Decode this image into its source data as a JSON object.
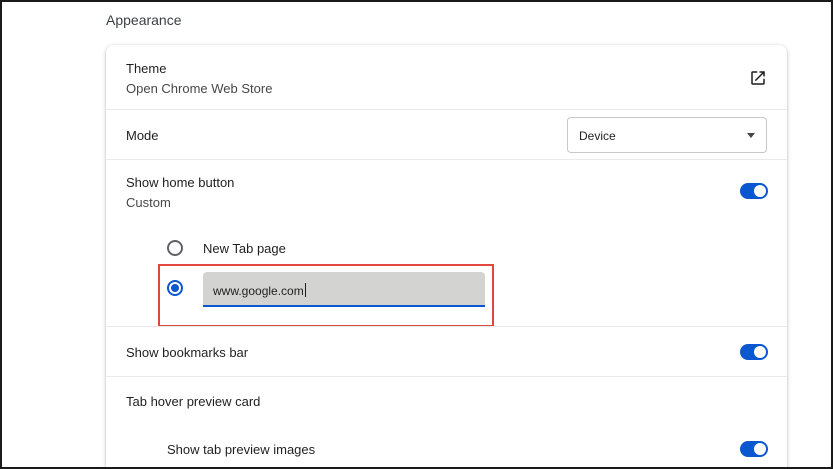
{
  "section": {
    "title": "Appearance"
  },
  "theme": {
    "label": "Theme",
    "sublabel": "Open Chrome Web Store",
    "icon": "open-in-new-icon"
  },
  "mode": {
    "label": "Mode",
    "selected": "Device"
  },
  "home_button": {
    "label": "Show home button",
    "sublabel": "Custom",
    "enabled": true,
    "options": [
      {
        "label": "New Tab page",
        "selected": false
      },
      {
        "label": "custom-url",
        "selected": true
      }
    ],
    "url_value": "www.google.com"
  },
  "bookmarks_bar": {
    "label": "Show bookmarks bar",
    "enabled": true
  },
  "tab_hover": {
    "label": "Tab hover preview card",
    "preview_images_label": "Show tab preview images",
    "preview_images_enabled": true
  },
  "colors": {
    "accent": "#0b57d0",
    "highlight": "#e0473d"
  }
}
